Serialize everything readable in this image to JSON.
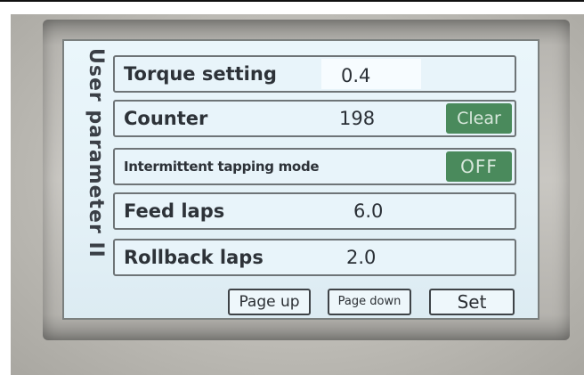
{
  "panel": {
    "title": "User parameter II"
  },
  "rows": [
    {
      "label": "Torque setting",
      "value": "0.4"
    },
    {
      "label": "Counter",
      "value": "198",
      "button": "Clear"
    },
    {
      "label": "Intermittent tapping mode",
      "button": "OFF"
    },
    {
      "label": "Feed laps",
      "value": "6.0"
    },
    {
      "label": "Rollback laps",
      "value": "2.0"
    }
  ],
  "footer": {
    "page_up": "Page up",
    "page_down": "Page down",
    "set": "Set"
  }
}
